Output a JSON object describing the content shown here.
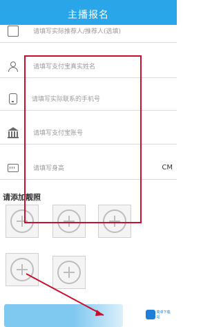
{
  "header": {
    "title": "主播报名"
  },
  "form": {
    "rows": [
      {
        "icon": "card-icon",
        "value": "请填写实际推荐人/推荐人(选填)",
        "unit": ""
      },
      {
        "icon": "person-icon",
        "value": "请填写支付宝真实姓名",
        "unit": ""
      },
      {
        "icon": "phone-icon",
        "value": "请填写实际联系的手机号",
        "unit": ""
      },
      {
        "icon": "bank-icon",
        "value": "请填写支付宝账号",
        "unit": ""
      },
      {
        "icon": "ruler-icon",
        "value": "请填写身高",
        "unit": "CM"
      }
    ]
  },
  "photos": {
    "label": "请添加靓照",
    "slot_count": 5
  },
  "colors": {
    "accent": "#29a6ea",
    "highlight": "#c8102e",
    "submit": "#7fc8f0"
  },
  "watermark": {
    "text": "简单下载站"
  }
}
